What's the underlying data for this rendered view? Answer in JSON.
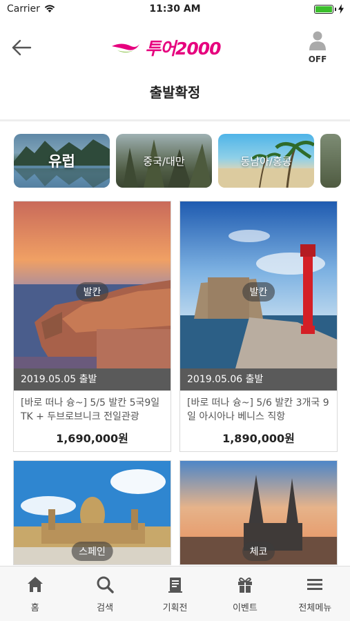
{
  "status_bar": {
    "carrier": "Carrier",
    "time": "11:30 AM"
  },
  "nav": {
    "logo_text": "투어2000",
    "user_status": "OFF"
  },
  "page_title": "출발확정",
  "categories": [
    {
      "label": "유럽"
    },
    {
      "label": "중국/대만"
    },
    {
      "label": "동남아/홍콩"
    }
  ],
  "products": [
    {
      "region": "발칸",
      "date": "2019.05.05 출발",
      "title": "[바로 떠나 슝~] 5/5 발칸 5국9일 TK + 두브로브니크 전일관광",
      "price": "1,690,000원"
    },
    {
      "region": "발칸",
      "date": "2019.05.06 출발",
      "title": "[바로 떠나 슝~] 5/6 발칸 3개국 9일 아시아나 베니스 직항",
      "price": "1,890,000원"
    },
    {
      "region": "스페인"
    },
    {
      "region": "체코"
    }
  ],
  "tabbar": {
    "items": [
      {
        "label": "홈",
        "icon": "home-icon"
      },
      {
        "label": "검색",
        "icon": "search-icon"
      },
      {
        "label": "기획전",
        "icon": "document-icon"
      },
      {
        "label": "이벤트",
        "icon": "gift-icon"
      },
      {
        "label": "전체메뉴",
        "icon": "menu-icon"
      }
    ]
  },
  "colors": {
    "brand": "#e6007e",
    "date_band": "#5a5a5a",
    "battery": "#3bbf2c"
  }
}
